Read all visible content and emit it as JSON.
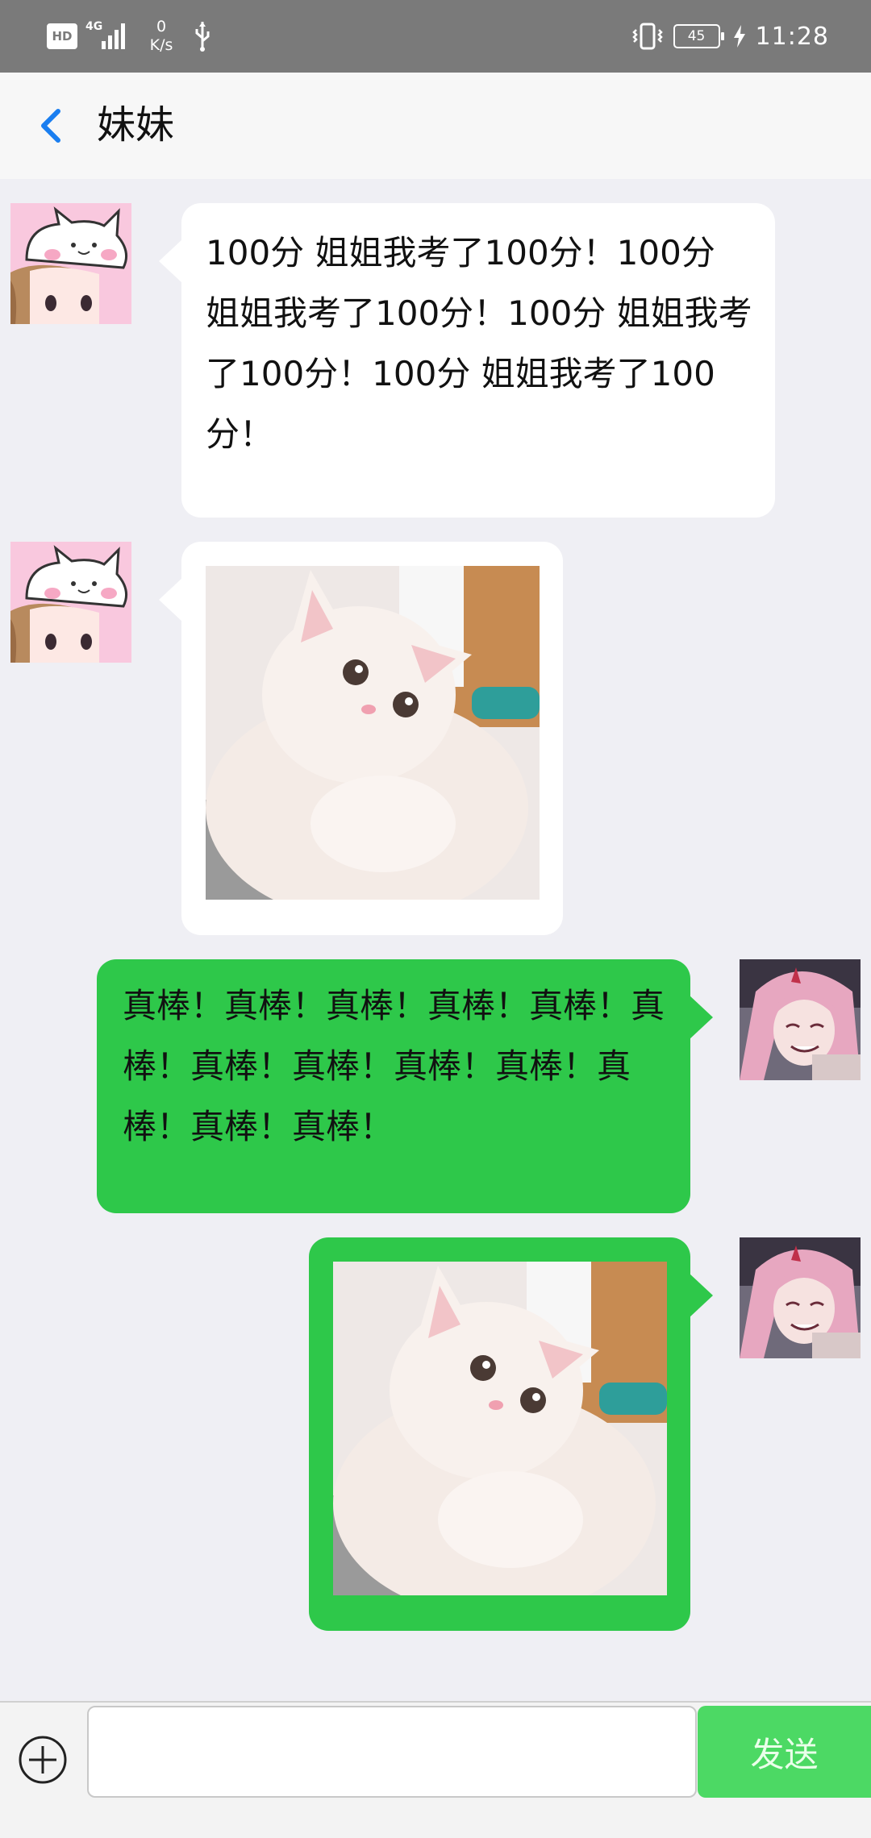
{
  "status_bar": {
    "hd": "HD",
    "network": "4G",
    "speed_value": "0",
    "speed_unit": "K/s",
    "battery": "45",
    "time": "11:28"
  },
  "header": {
    "title": "妹妹"
  },
  "messages": [
    {
      "sender": "other",
      "type": "text",
      "text": "100分 姐姐我考了100分！100分 姐姐我考了100分！100分 姐姐我考了100分！100分 姐姐我考了100分！"
    },
    {
      "sender": "other",
      "type": "image",
      "image": "white kitten photo"
    },
    {
      "sender": "me",
      "type": "text",
      "text": "真棒！真棒！真棒！真棒！真棒！真棒！真棒！真棒！真棒！真棒！真棒！真棒！真棒！"
    },
    {
      "sender": "me",
      "type": "image",
      "image": "white kitten photo"
    }
  ],
  "input_bar": {
    "placeholder": "",
    "send_label": "发送"
  },
  "colors": {
    "accent": "#1a7ef0",
    "my_bubble": "#2ec84a",
    "send_button": "#4cd964",
    "background": "#efeff4"
  }
}
